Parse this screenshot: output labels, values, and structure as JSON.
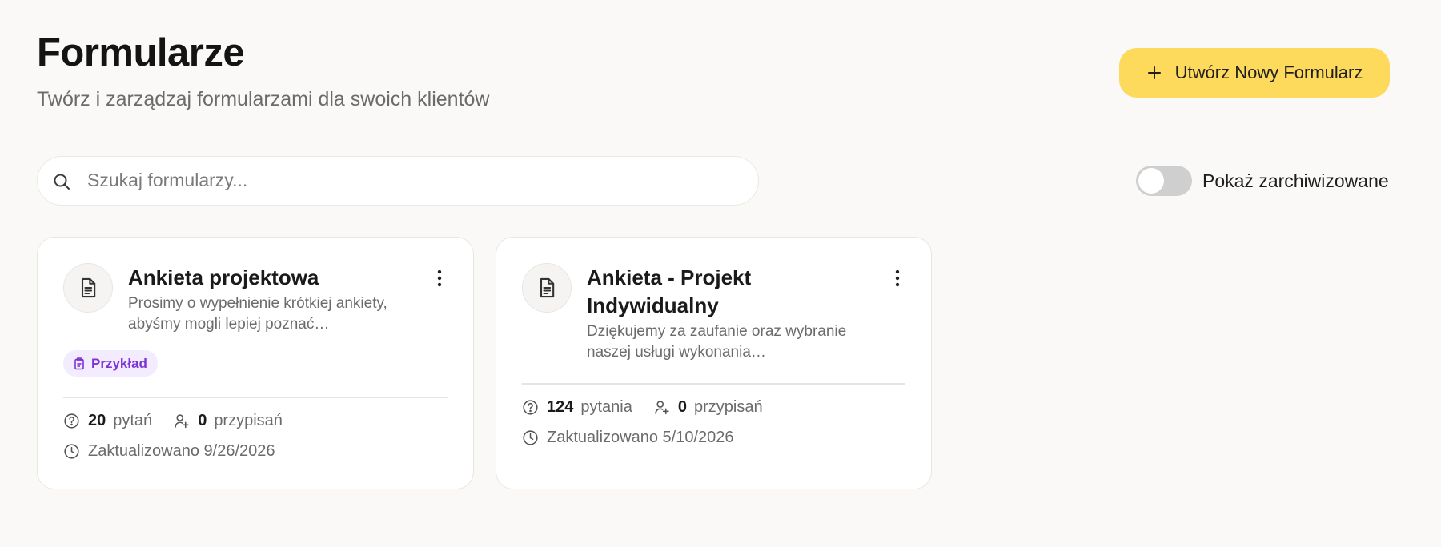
{
  "header": {
    "title": "Formularze",
    "subtitle": "Twórz i zarządzaj formularzami dla swoich klientów",
    "create_button_label": "Utwórz Nowy Formularz"
  },
  "search": {
    "placeholder": "Szukaj formularzy...",
    "value": ""
  },
  "archived_toggle": {
    "label": "Pokaż zarchiwizowane",
    "on": false
  },
  "forms": [
    {
      "title": "Ankieta projektowa",
      "description": "Prosimy o wypełnienie krótkiej ankiety, abyśmy mogli lepiej poznać…",
      "badge": "Przykład",
      "questions_count": "20",
      "questions_label": "pytań",
      "assignments_count": "0",
      "assignments_label": "przypisań",
      "updated": "Zaktualizowano 9/26/2026"
    },
    {
      "title": "Ankieta - Projekt Indywidualny",
      "description": "Dziękujemy za zaufanie oraz wybranie naszej usługi wykonania…",
      "questions_count": "124",
      "questions_label": "pytania",
      "assignments_count": "0",
      "assignments_label": "przypisań",
      "updated": "Zaktualizowano 5/10/2026"
    }
  ],
  "colors": {
    "background": "#faf9f7",
    "accent_button": "#fdd95c",
    "badge_bg": "#f3ecff",
    "badge_text": "#7b33d6",
    "toggle_off": "#cfcfcf"
  },
  "icons": {
    "create": "plus-icon",
    "search": "search-icon",
    "form": "document-icon",
    "menu": "more-vertical-icon",
    "badge": "clipboard-icon",
    "questions": "help-circle-icon",
    "assignments": "user-plus-icon",
    "updated": "clock-icon"
  }
}
